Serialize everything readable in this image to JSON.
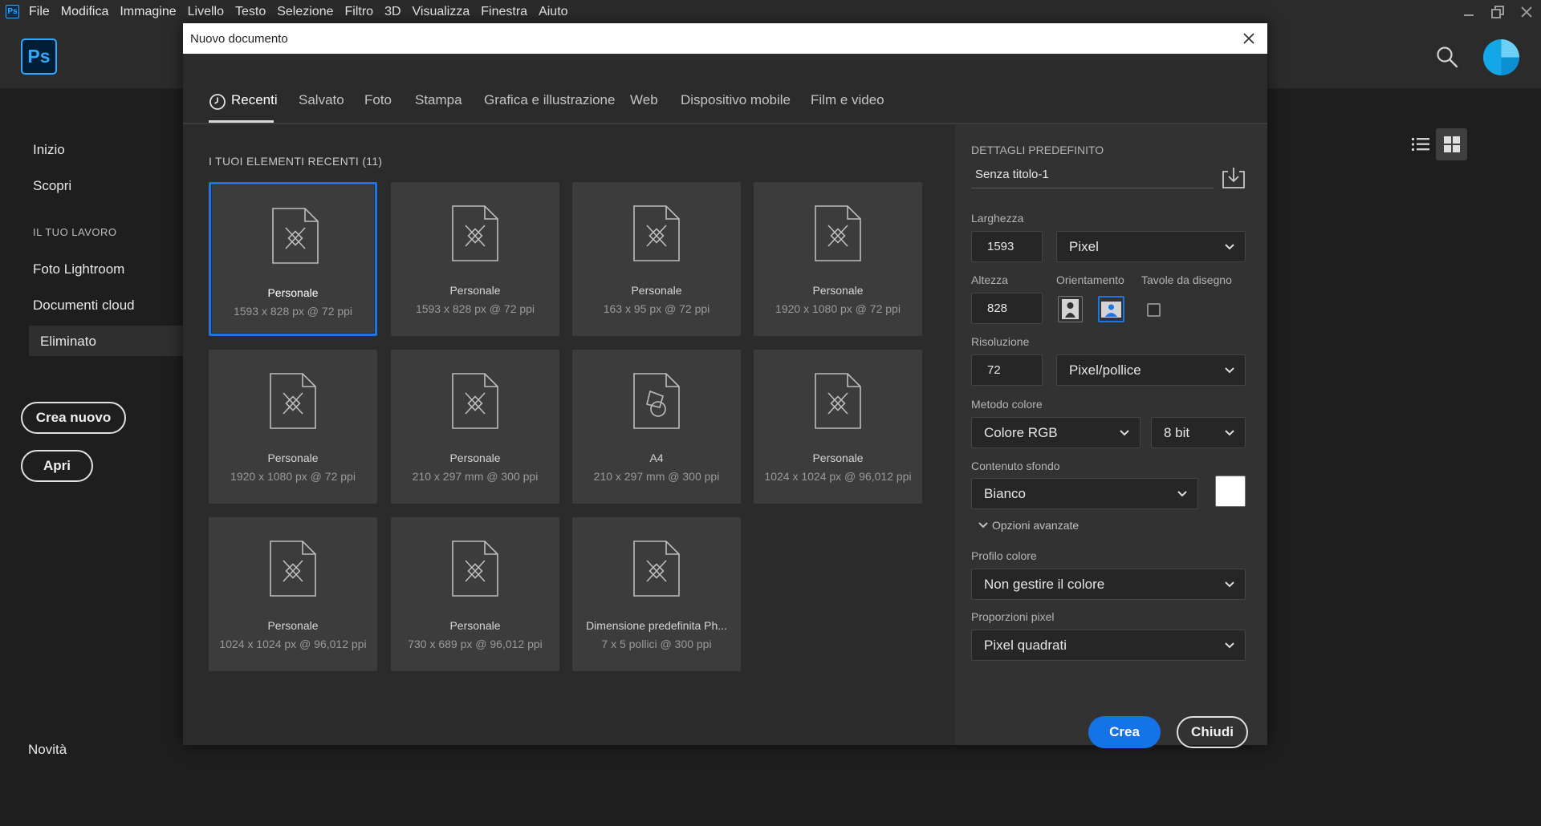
{
  "menubar": {
    "app_icon": "Ps",
    "items": [
      "File",
      "Modifica",
      "Immagine",
      "Livello",
      "Testo",
      "Selezione",
      "Filtro",
      "3D",
      "Visualizza",
      "Finestra",
      "Aiuto"
    ]
  },
  "home": {
    "logo": "Ps",
    "nav": {
      "inizio": "Inizio",
      "scopri": "Scopri",
      "section": "IL TUO LAVORO",
      "foto_lightroom": "Foto Lightroom",
      "documenti_cloud": "Documenti cloud",
      "eliminato": "Eliminato"
    },
    "crea_nuovo": "Crea nuovo",
    "apri": "Apri",
    "novita": "Novità"
  },
  "dialog": {
    "title": "Nuovo documento",
    "tabs": [
      "Recenti",
      "Salvato",
      "Foto",
      "Stampa",
      "Grafica e illustrazione",
      "Web",
      "Dispositivo mobile",
      "Film e video"
    ],
    "recent_heading": "I TUOI ELEMENTI RECENTI",
    "recent_count": "(11)",
    "cards": [
      {
        "name": "Personale",
        "dims": "1593 x 828 px @ 72 ppi"
      },
      {
        "name": "Personale",
        "dims": "1593 x 828 px @ 72 ppi"
      },
      {
        "name": "Personale",
        "dims": "163 x 95 px @ 72 ppi"
      },
      {
        "name": "Personale",
        "dims": "1920 x 1080 px @ 72 ppi"
      },
      {
        "name": "Personale",
        "dims": "1920 x 1080 px @ 72 ppi"
      },
      {
        "name": "Personale",
        "dims": "210 x 297 mm @ 300 ppi"
      },
      {
        "name": "A4",
        "dims": "210 x 297 mm @ 300 ppi"
      },
      {
        "name": "Personale",
        "dims": "1024 x 1024 px @ 96,012 ppi"
      },
      {
        "name": "Personale",
        "dims": "1024 x 1024 px @ 96,012 ppi"
      },
      {
        "name": "Personale",
        "dims": "730 x 689 px @ 96,012 ppi"
      },
      {
        "name": "Dimensione predefinita Ph...",
        "dims": "7 x 5 pollici @ 300 ppi"
      }
    ],
    "details": {
      "heading": "DETTAGLI PREDEFINITO",
      "preset_name": "Senza titolo-1",
      "larghezza_label": "Larghezza",
      "larghezza": "1593",
      "larghezza_unit": "Pixel",
      "altezza_label": "Altezza",
      "altezza": "828",
      "orientamento_label": "Orientamento",
      "tavole_label": "Tavole da disegno",
      "risoluzione_label": "Risoluzione",
      "risoluzione": "72",
      "risoluzione_unit": "Pixel/pollice",
      "metodo_label": "Metodo colore",
      "metodo": "Colore RGB",
      "bit": "8 bit",
      "sfondo_label": "Contenuto sfondo",
      "sfondo": "Bianco",
      "opzioni": "Opzioni avanzate",
      "profilo_label": "Profilo colore",
      "profilo": "Non gestire il colore",
      "proporzioni_label": "Proporzioni pixel",
      "proporzioni": "Pixel quadrati",
      "crea": "Crea",
      "chiudi": "Chiudi"
    }
  },
  "colors": {
    "accent": "#1473e6",
    "ps_blue": "#31a8ff",
    "background": "#1e1e1e",
    "panel": "#2b2b2b"
  }
}
